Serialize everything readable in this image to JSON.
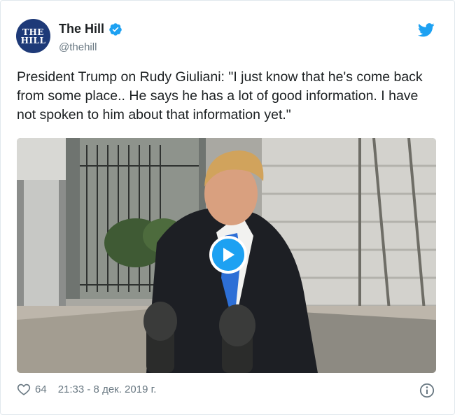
{
  "author": {
    "avatar_line1": "THE",
    "avatar_line2": "HILL",
    "name": "The Hill",
    "handle": "@thehill"
  },
  "tweet": {
    "text": "President Trump on Rudy Giuliani: \"I just know that he's come back from some place.. He says he has a lot of good information. I have not spoken to him about that information yet.\""
  },
  "footer": {
    "likes": "64",
    "timestamp": "21:33 - 8 дек. 2019 г."
  },
  "icons": {
    "verified": "verified-badge-icon",
    "twitter": "twitter-bird-icon",
    "play": "play-icon",
    "heart": "heart-icon",
    "info": "info-icon"
  },
  "colors": {
    "brand_blue": "#1da1f2",
    "avatar_bg": "#1e3a78",
    "muted_text": "#697882"
  }
}
